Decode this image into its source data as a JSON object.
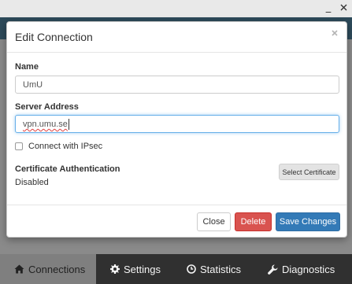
{
  "window": {
    "minimize_glyph": "_",
    "close_icon": "x-icon"
  },
  "tabs": [
    {
      "label": "Connections",
      "icon": "home-icon",
      "active": true
    },
    {
      "label": "Settings",
      "icon": "gear-icon",
      "active": false
    },
    {
      "label": "Statistics",
      "icon": "clock-icon",
      "active": false
    },
    {
      "label": "Diagnostics",
      "icon": "wrench-icon",
      "active": false
    }
  ],
  "modal": {
    "title": "Edit Connection",
    "close_icon": "close-icon",
    "name": {
      "label": "Name",
      "value": "UmU"
    },
    "server": {
      "label": "Server Address",
      "value": "vpn.umu.se"
    },
    "ipsec": {
      "label": "Connect with IPsec",
      "checked": false
    },
    "certificate": {
      "label": "Certificate Authentication",
      "status": "Disabled",
      "select_button": "Select Certificate"
    },
    "footer": {
      "close_label": "Close",
      "delete_label": "Delete",
      "save_label": "Save Changes"
    }
  },
  "colors": {
    "header_bg": "#2d4a5a",
    "tabbar_bg": "#303030",
    "active_tab_bg": "#7f7f7f",
    "primary": "#337ab7",
    "danger": "#d9534f",
    "focus": "#66afe9"
  }
}
